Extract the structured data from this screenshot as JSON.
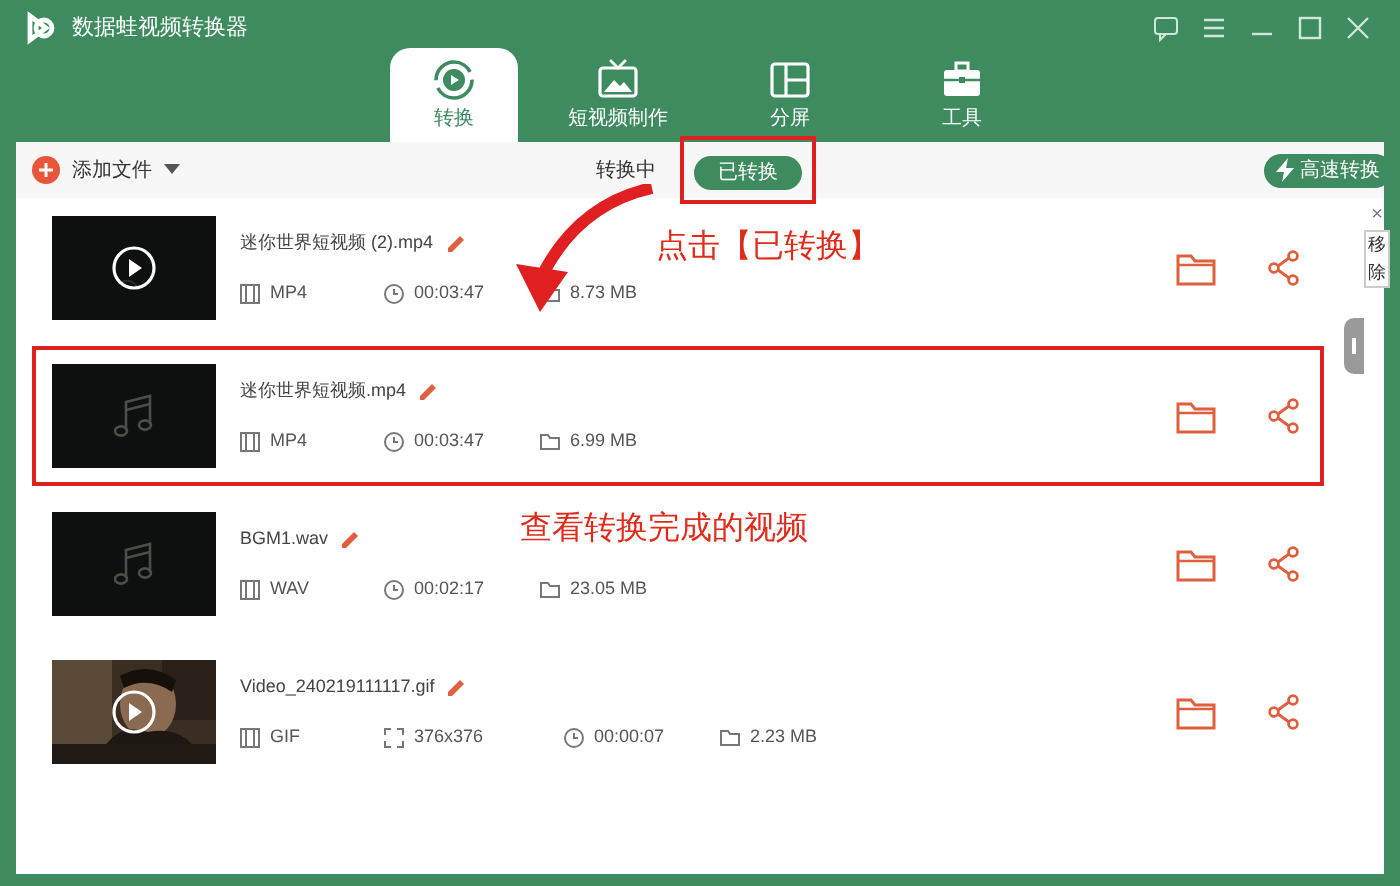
{
  "window": {
    "title": "数据蛙视频转换器"
  },
  "tabs": [
    {
      "label": "转换",
      "selected": true,
      "kind": "convert"
    },
    {
      "label": "短视频制作",
      "selected": false,
      "kind": "tv"
    },
    {
      "label": "分屏",
      "selected": false,
      "kind": "split"
    },
    {
      "label": "工具",
      "selected": false,
      "kind": "toolbox"
    }
  ],
  "toolbar": {
    "add_file": "添加文件",
    "status_tabs": [
      {
        "label": "转换中",
        "selected": false,
        "annotated": false
      },
      {
        "label": "已转换",
        "selected": true,
        "annotated": true
      }
    ],
    "fast_convert": "高速转换"
  },
  "files": [
    {
      "name": "迷你世界短视频 (2).mp4",
      "kind": "video",
      "format": "MP4",
      "duration": "00:03:47",
      "size": "8.73 MB",
      "annotated": false
    },
    {
      "name": "迷你世界短视频.mp4",
      "kind": "audio",
      "format": "MP4",
      "duration": "00:03:47",
      "size": "6.99 MB",
      "annotated": true
    },
    {
      "name": "BGM1.wav",
      "kind": "audio",
      "format": "WAV",
      "duration": "00:02:17",
      "size": "23.05 MB",
      "annotated": false
    },
    {
      "name": "Video_240219111117.gif",
      "kind": "picture",
      "format": "GIF",
      "resolution": "376x376",
      "duration": "00:00:07",
      "size": "2.23 MB",
      "annotated": false
    }
  ],
  "side_panel": {
    "close": "×",
    "label": "移除"
  },
  "annotations": [
    {
      "kind": "callout",
      "text": "点击【已转换】"
    },
    {
      "kind": "arrow"
    },
    {
      "kind": "callout",
      "text": "查看转换完成的视频"
    }
  ]
}
